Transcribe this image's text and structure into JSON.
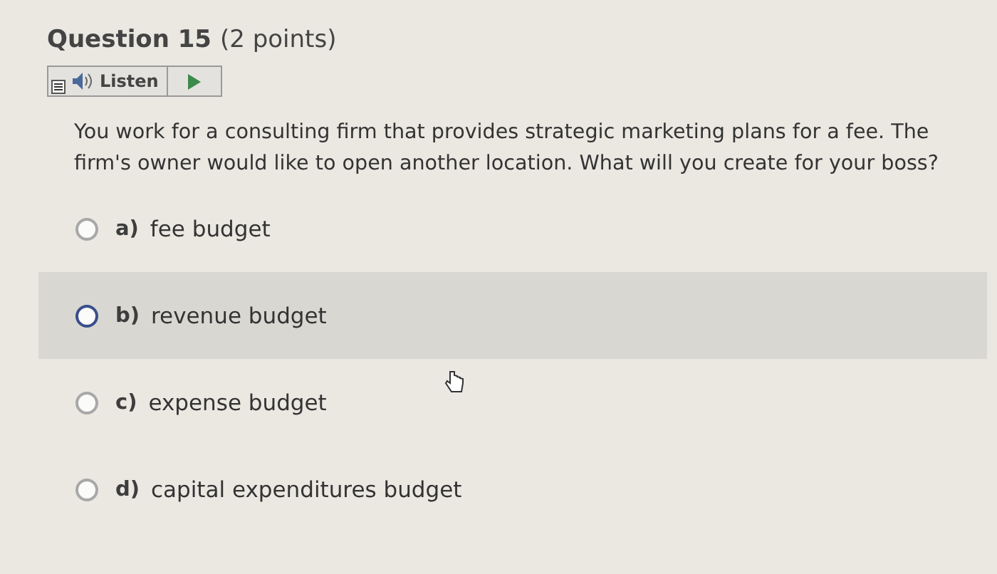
{
  "question": {
    "title": "Question 15",
    "points": "(2 points)"
  },
  "listen": {
    "label": "Listen"
  },
  "prompt": "You work for a consulting firm that provides strategic marketing plans for a fee. The firm's owner would like to open another location. What will you create for your boss?",
  "options": [
    {
      "letter": "a)",
      "text": "fee budget",
      "selected": false,
      "highlighted": false
    },
    {
      "letter": "b)",
      "text": "revenue budget",
      "selected": false,
      "highlighted": true
    },
    {
      "letter": "c)",
      "text": "expense budget",
      "selected": false,
      "highlighted": false
    },
    {
      "letter": "d)",
      "text": "capital expenditures budget",
      "selected": false,
      "highlighted": false
    }
  ]
}
